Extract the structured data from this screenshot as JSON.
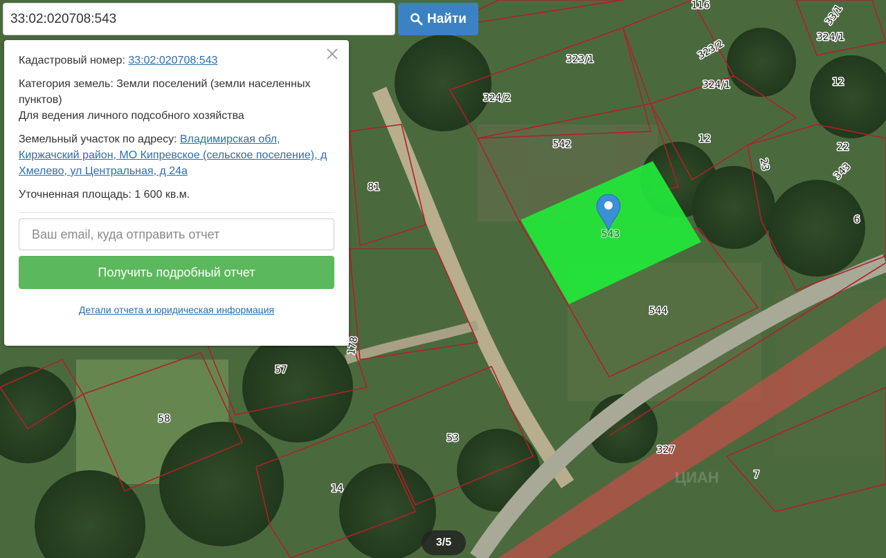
{
  "search": {
    "value": "33:02:020708:543",
    "button_label": "Найти",
    "button_icon": "search-icon"
  },
  "popup": {
    "cadastral_label": "Кадастровый номер:",
    "cadastral_value": "33:02:020708:543",
    "category_label": "Категория земель:",
    "category_value": "Земли поселений (земли населенных пунктов)",
    "usage": "Для ведения личного подсобного хозяйства",
    "address_label": "Земельный участок по адресу:",
    "address_value": "Владимирская обл, Киржачский район, МО Кипревское (сельское поселение), д Хмелево, ул Центральная, д 24а",
    "area_label": "Уточненная площадь:",
    "area_value": "1 600 кв.м.",
    "email_placeholder": "Ваш email, куда отправить отчет",
    "report_button": "Получить подробный отчет",
    "details_link": "Детали отчета и юридическая информация",
    "close_icon": "close-icon"
  },
  "map": {
    "highlight_color": "#22e83a",
    "boundary_color": "#b0202a",
    "marker_color": "#3a8fd6",
    "plot_labels": [
      "116",
      "323/2",
      "33/1",
      "324/1",
      "323/1",
      "324/2",
      "324/1",
      "12",
      "542",
      "12",
      "22",
      "23",
      "343",
      "81",
      "543",
      "6",
      "544",
      "178",
      "57",
      "58",
      "53",
      "327",
      "7",
      "14"
    ]
  },
  "pager": {
    "text": "3/5"
  },
  "watermark": "ЦИАН"
}
